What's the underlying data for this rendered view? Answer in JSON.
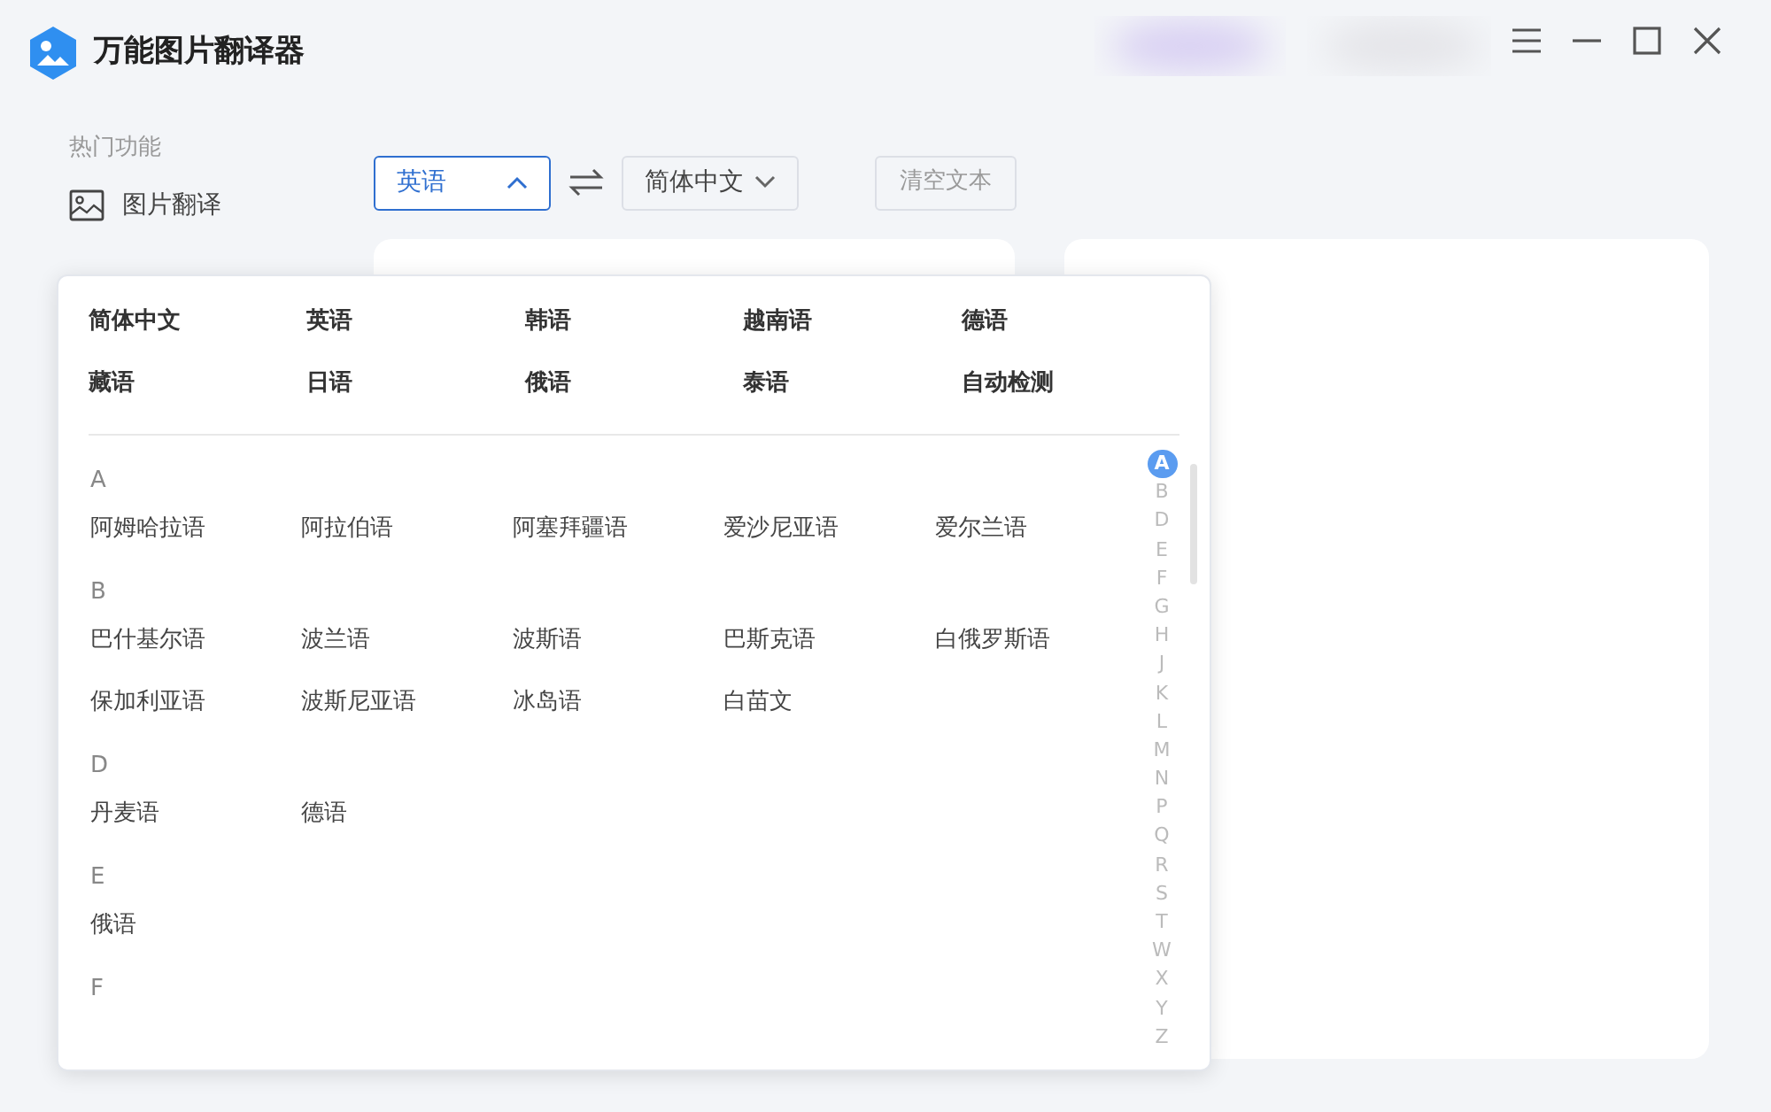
{
  "window": {
    "title": "万能图片翻译器"
  },
  "sidebar": {
    "heading": "热门功能",
    "items": [
      {
        "label": "图片翻译",
        "selected": false
      }
    ]
  },
  "toolbar": {
    "source_language": {
      "value": "英语",
      "expanded": true
    },
    "target_language": {
      "value": "简体中文",
      "expanded": false
    },
    "clear_button": {
      "label": "清空文本",
      "disabled": true
    }
  },
  "language_menu": {
    "hot_languages": [
      "简体中文",
      "英语",
      "韩语",
      "越南语",
      "德语",
      "藏语",
      "日语",
      "俄语",
      "泰语",
      "自动检测"
    ],
    "sections": [
      {
        "letter": "A",
        "languages": [
          "阿姆哈拉语",
          "阿拉伯语",
          "阿塞拜疆语",
          "爱沙尼亚语",
          "爱尔兰语"
        ]
      },
      {
        "letter": "B",
        "languages": [
          "巴什基尔语",
          "波兰语",
          "波斯语",
          "巴斯克语",
          "白俄罗斯语",
          "保加利亚语",
          "波斯尼亚语",
          "冰岛语",
          "白苗文"
        ]
      },
      {
        "letter": "D",
        "languages": [
          "丹麦语",
          "德语"
        ]
      },
      {
        "letter": "E",
        "languages": [
          "俄语"
        ]
      },
      {
        "letter": "F"
      }
    ],
    "index": [
      {
        "letter": "A",
        "selected": true
      },
      {
        "letter": "B",
        "selected": false
      },
      {
        "letter": "D",
        "selected": false
      },
      {
        "letter": "E",
        "selected": false
      },
      {
        "letter": "F",
        "selected": false
      },
      {
        "letter": "G",
        "selected": false
      },
      {
        "letter": "H",
        "selected": false
      },
      {
        "letter": "J",
        "selected": false
      },
      {
        "letter": "K",
        "selected": false
      },
      {
        "letter": "L",
        "selected": false
      },
      {
        "letter": "M",
        "selected": false
      },
      {
        "letter": "N",
        "selected": false
      },
      {
        "letter": "P",
        "selected": false
      },
      {
        "letter": "Q",
        "selected": false
      },
      {
        "letter": "R",
        "selected": false
      },
      {
        "letter": "S",
        "selected": false
      },
      {
        "letter": "T",
        "selected": false
      },
      {
        "letter": "W",
        "selected": false
      },
      {
        "letter": "X",
        "selected": false
      },
      {
        "letter": "Y",
        "selected": false
      },
      {
        "letter": "Z",
        "selected": false
      }
    ]
  }
}
